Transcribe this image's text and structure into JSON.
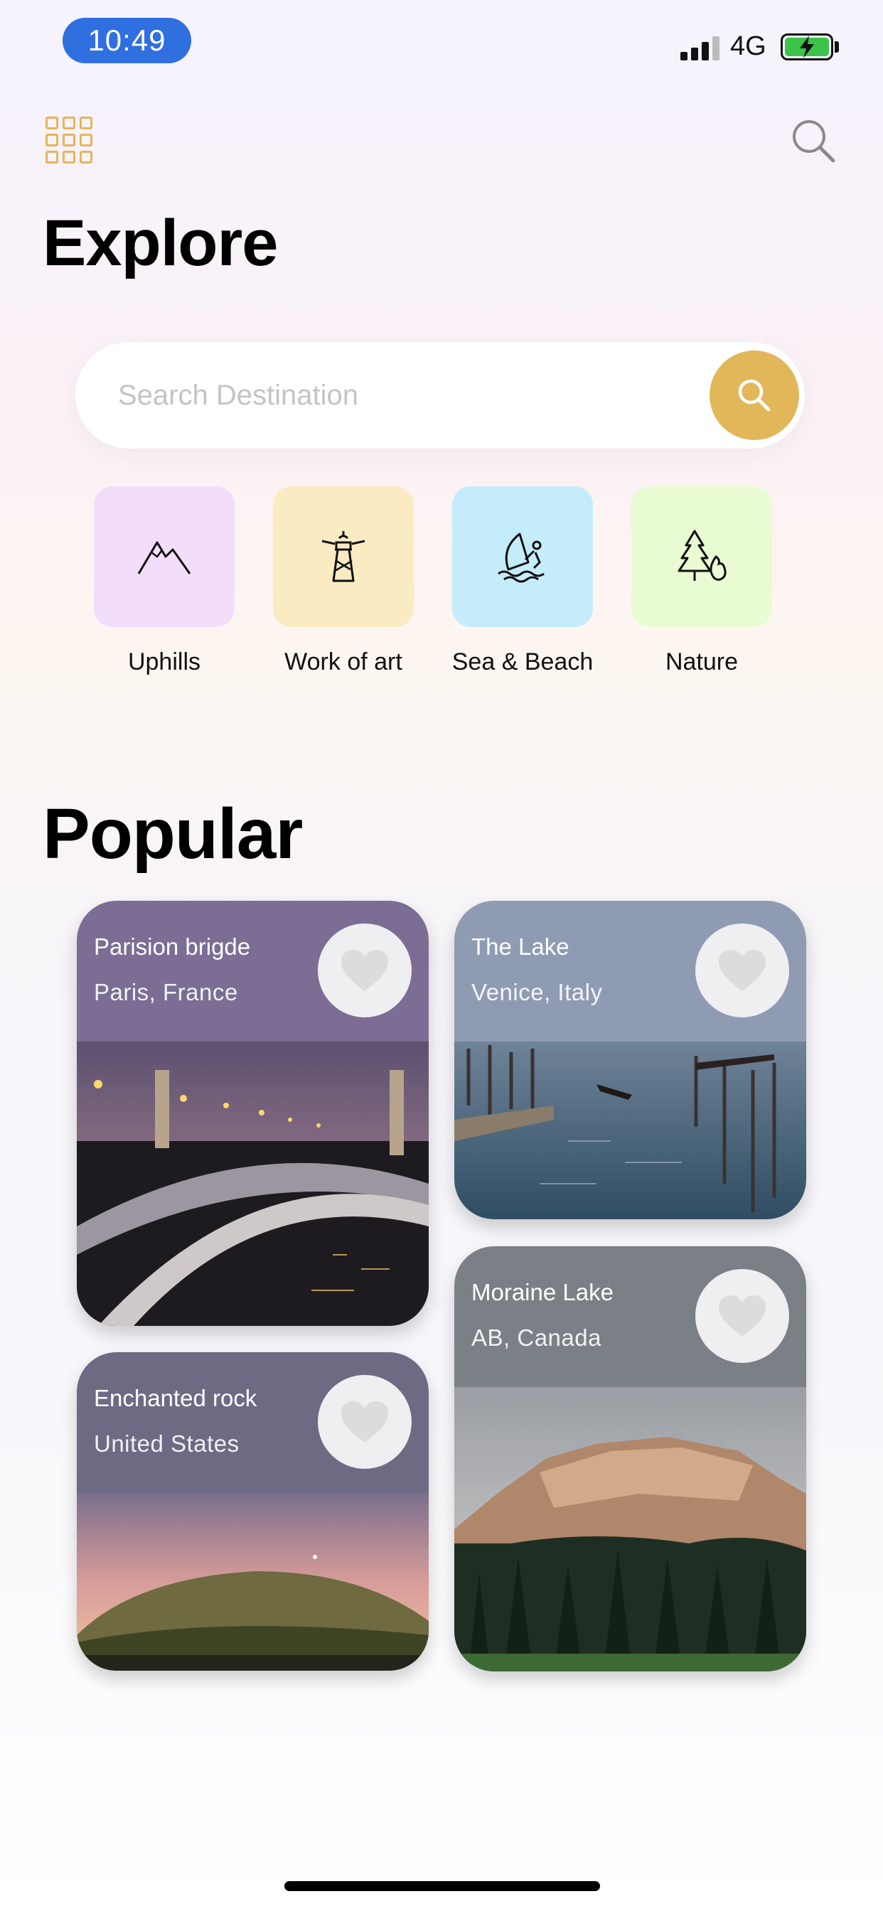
{
  "status_bar": {
    "time": "10:49",
    "network": "4G"
  },
  "header": {
    "title": "Explore"
  },
  "search": {
    "placeholder": "Search Destination"
  },
  "categories": [
    {
      "label": "Uphills",
      "icon": "mountain-icon",
      "color": "#f2defa"
    },
    {
      "label": "Work of art",
      "icon": "lighthouse-icon",
      "color": "#fbebc2"
    },
    {
      "label": "Sea & Beach",
      "icon": "windsurf-icon",
      "color": "#c5ecfa"
    },
    {
      "label": "Nature",
      "icon": "forest-icon",
      "color": "#e9fbd3"
    }
  ],
  "popular": {
    "title": "Popular",
    "cards": [
      {
        "title": "Parision brigde",
        "subtitle": "Paris, France"
      },
      {
        "title": "The Lake",
        "subtitle": "Venice, Italy"
      },
      {
        "title": "Enchanted rock",
        "subtitle": "United States"
      },
      {
        "title": "Moraine Lake",
        "subtitle": "AB, Canada"
      }
    ]
  },
  "colors": {
    "accent": "#e2b75a",
    "time_pill": "#2f6fe0"
  }
}
